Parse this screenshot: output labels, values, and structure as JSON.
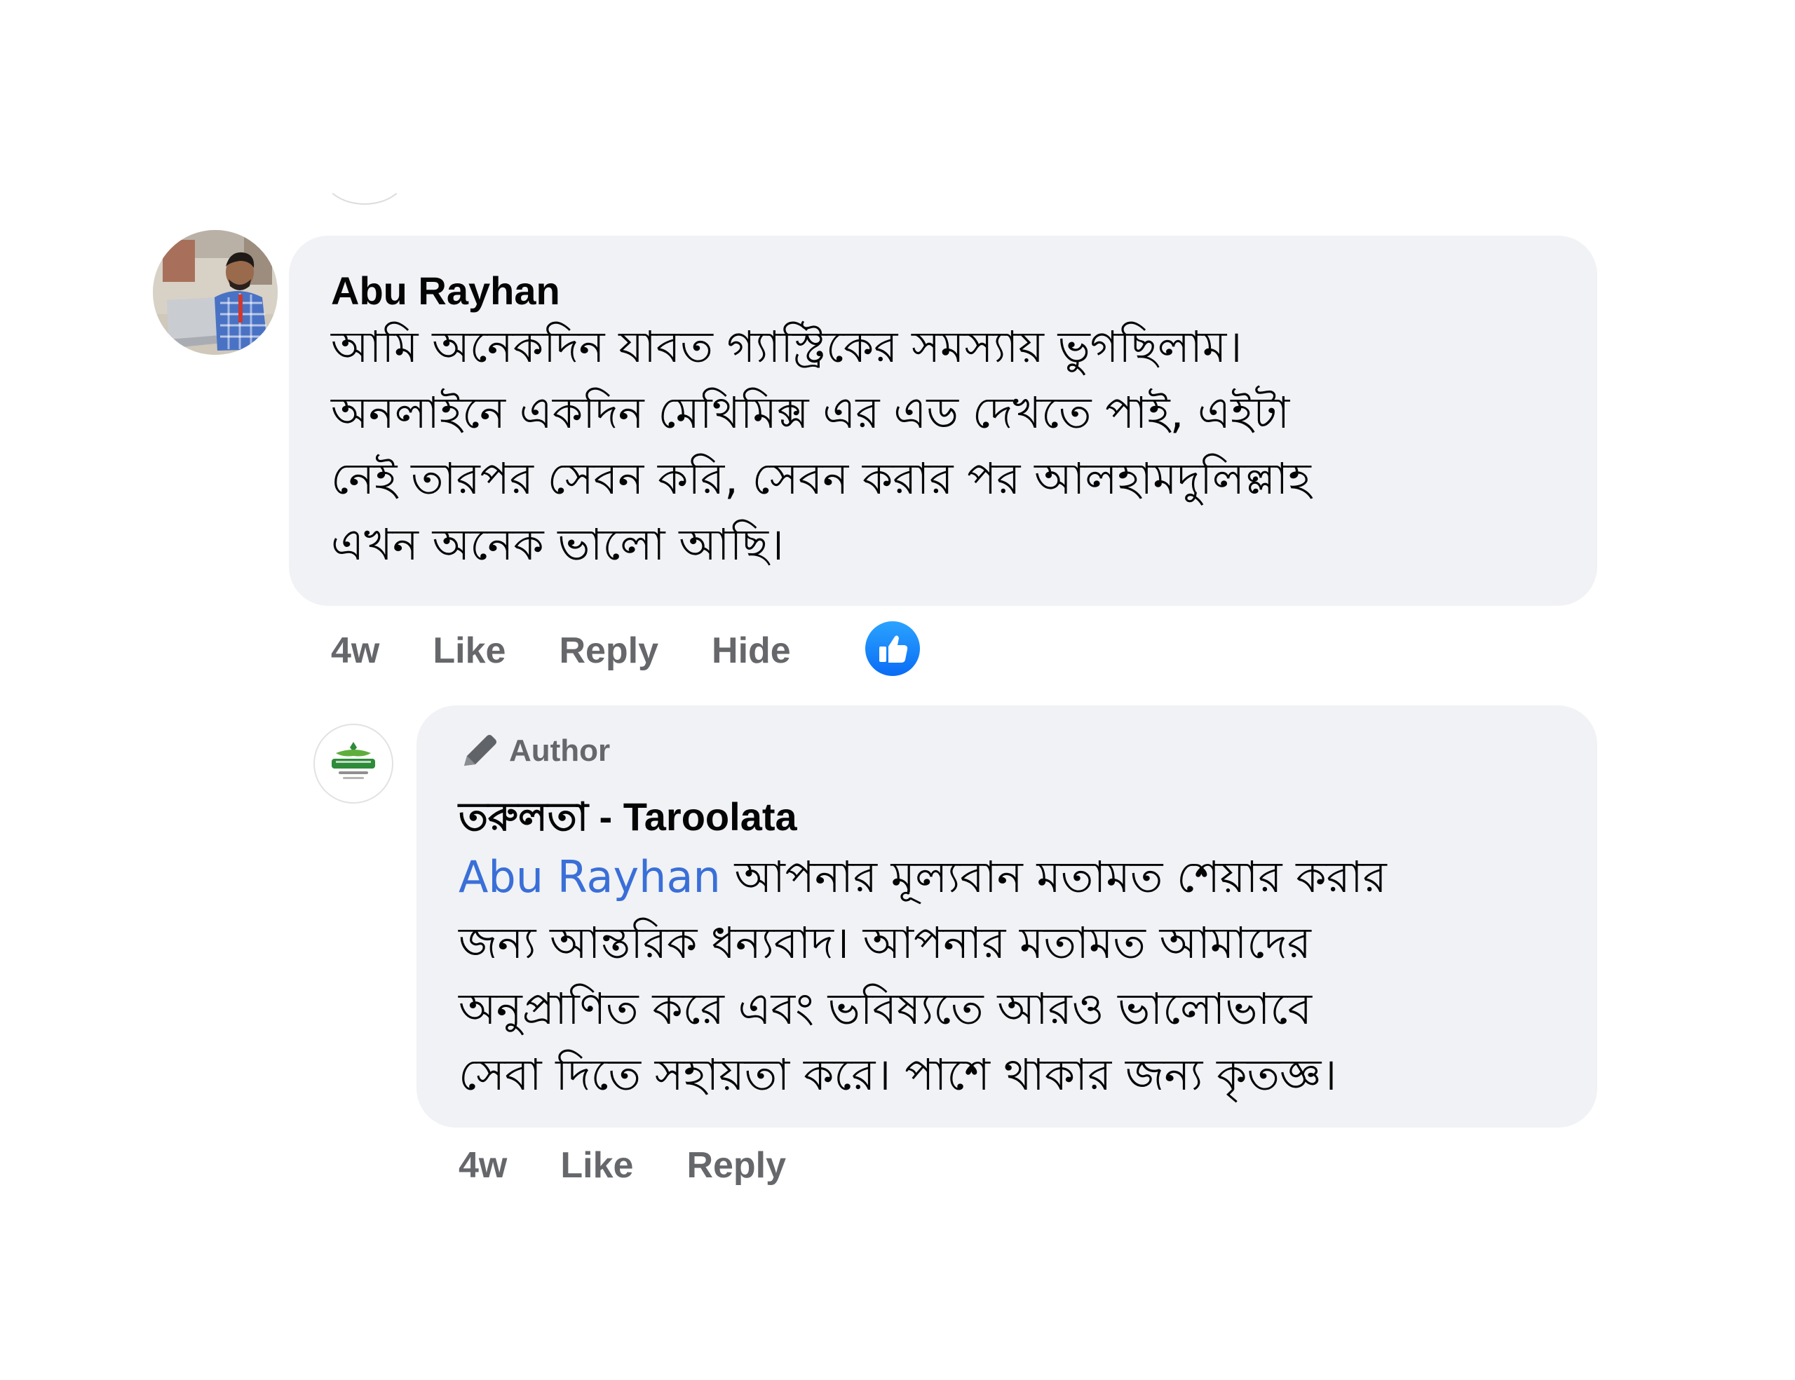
{
  "comment": {
    "author": "Abu Rayhan",
    "text_lines": [
      "আমি অনেকদিন যাবত গ্যাস্ট্রিকের সমস্যায় ভুগছিলাম।",
      "অনলাইনে একদিন মেথিমিক্স এর এড দেখতে পাই, এইটা",
      "নেই তারপর সেবন করি, সেবন করার পর আলহামদুলিল্লাহ",
      "এখন অনেক ভালো আছি।"
    ],
    "time": "4w",
    "like_label": "Like",
    "reply_label": "Reply",
    "hide_label": "Hide",
    "reaction_icon": "like-reaction-icon",
    "reaction_color": "#0a6cf5"
  },
  "reply": {
    "badge_label": "Author",
    "badge_icon": "pencil-icon",
    "author": "তরুলতা - Taroolata",
    "mention": "Abu Rayhan",
    "first_line_rest": " আপনার মূল্যবান মতামত শেয়ার করার",
    "text_lines": [
      "জন্য আন্তরিক ধন্যবাদ। আপনার মতামত আমাদের",
      "অনুপ্রাণিত করে এবং ভবিষ্যতে আরও ভালোভাবে",
      "সেবা দিতে সহায়তা করে। পাশে থাকার জন্য কৃতজ্ঞ।"
    ],
    "time": "4w",
    "like_label": "Like",
    "reply_label": "Reply"
  },
  "colors": {
    "bubble_bg": "#f0f2f5",
    "secondary_text": "#65676b",
    "mention": "#3a6fd8",
    "brand_green": "#2e8b3a"
  }
}
